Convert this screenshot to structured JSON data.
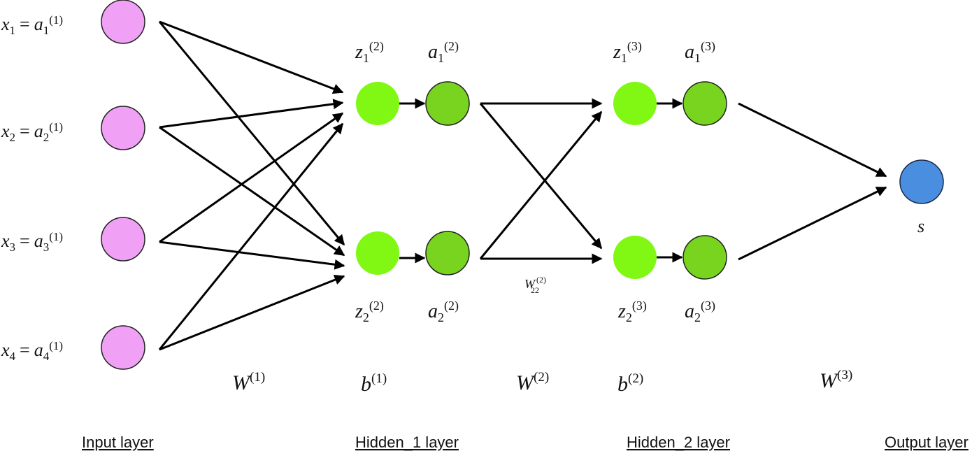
{
  "colors": {
    "input_node": "#f0a0f5",
    "z_node": "#80f814",
    "a_node": "#78d41f",
    "output_node": "#4a8fdf",
    "edge": "#000000"
  },
  "input_layer": {
    "label": "Input layer",
    "nodes": [
      {
        "lhs": "x",
        "lhs_sub": "1",
        "rhs": "a",
        "rhs_sub": "1",
        "rhs_sup": "(1)"
      },
      {
        "lhs": "x",
        "lhs_sub": "2",
        "rhs": "a",
        "rhs_sub": "2",
        "rhs_sup": "(1)"
      },
      {
        "lhs": "x",
        "lhs_sub": "3",
        "rhs": "a",
        "rhs_sub": "3",
        "rhs_sup": "(1)"
      },
      {
        "lhs": "x",
        "lhs_sub": "4",
        "rhs": "a",
        "rhs_sub": "4",
        "rhs_sup": "(1)"
      }
    ]
  },
  "weights": [
    {
      "sym": "W",
      "sup": "(1)"
    },
    {
      "sym": "W",
      "sup": "(2)"
    },
    {
      "sym": "W",
      "sup": "(3)"
    }
  ],
  "biases": [
    {
      "sym": "b",
      "sup": "(1)"
    },
    {
      "sym": "b",
      "sup": "(2)"
    }
  ],
  "hidden_layers": [
    {
      "label": "Hidden_1 layer",
      "units": [
        {
          "z": "z",
          "z_sub": "1",
          "z_sup": "(2)",
          "a": "a",
          "a_sub": "1",
          "a_sup": "(2)"
        },
        {
          "z": "z",
          "z_sub": "2",
          "z_sup": "(2)",
          "a": "a",
          "a_sub": "2",
          "a_sup": "(2)"
        }
      ]
    },
    {
      "label": "Hidden_2 layer",
      "units": [
        {
          "z": "z",
          "z_sub": "1",
          "z_sup": "(3)",
          "a": "a",
          "a_sub": "1",
          "a_sup": "(3)"
        },
        {
          "z": "z",
          "z_sub": "2",
          "z_sup": "(3)",
          "a": "a",
          "a_sub": "2",
          "a_sup": "(3)"
        }
      ]
    }
  ],
  "edge_annotation": {
    "sym": "W",
    "sub": "22",
    "sup": "(2)"
  },
  "output_layer": {
    "label": "Output layer",
    "node_label": "s"
  }
}
